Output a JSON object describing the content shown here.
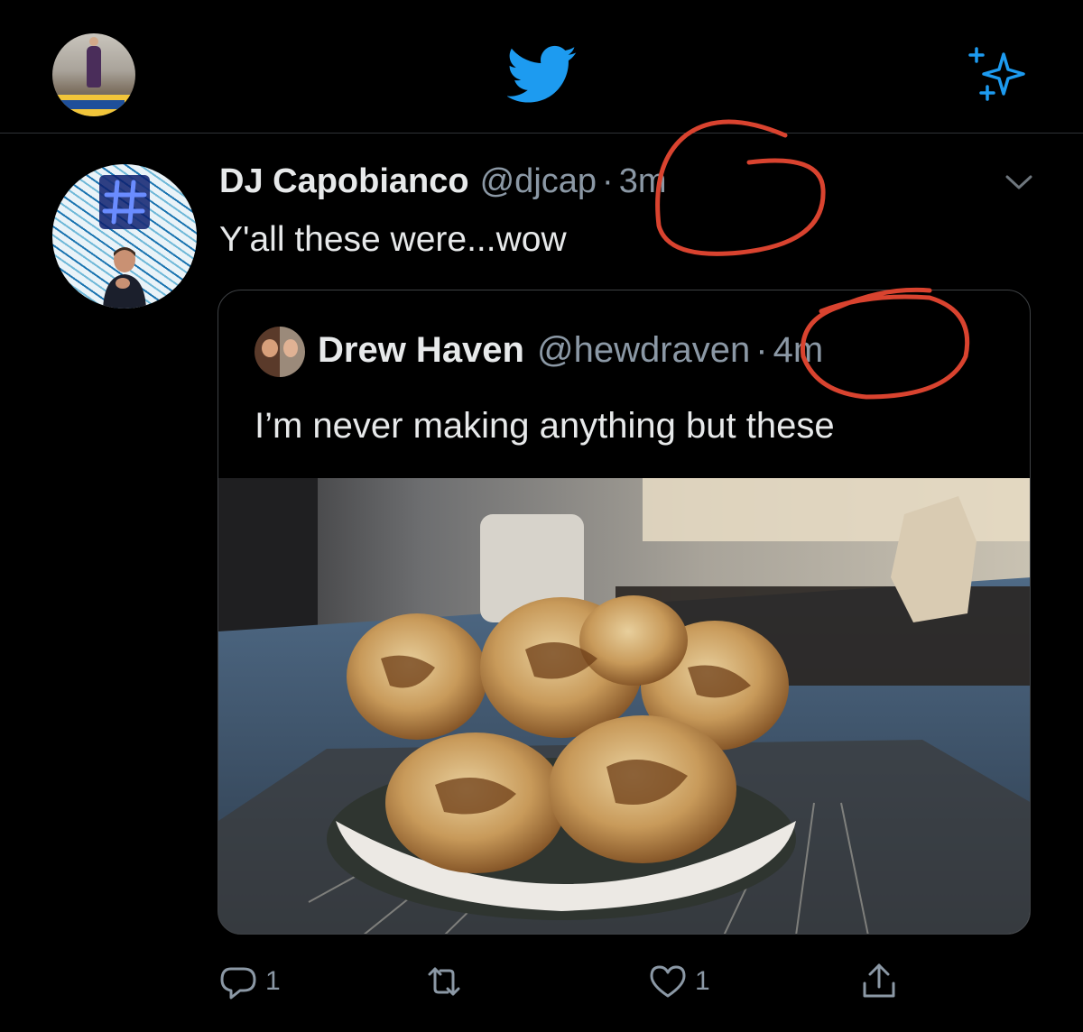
{
  "header": {
    "logo_icon": "twitter-bird-icon",
    "sparkle_icon": "sparkle-icon",
    "brand_color": "#1d9bf0"
  },
  "tweet": {
    "author_name": "DJ Capobianco",
    "handle": "@djcap",
    "separator": "·",
    "time": "3m",
    "text": "Y'all these were...wow",
    "more_icon": "chevron-down-icon",
    "quote": {
      "author_name": "Drew Haven",
      "handle": "@hewdraven",
      "separator": "·",
      "time": "4m",
      "text": "I’m never making anything but these"
    },
    "actions": {
      "reply_count": "1",
      "retweet_count": "",
      "like_count": "1"
    }
  },
  "annotation_color": "#d9432f"
}
